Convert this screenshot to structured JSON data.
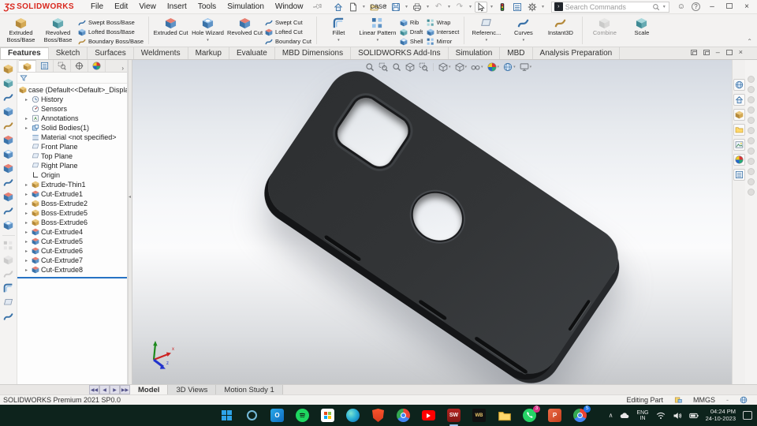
{
  "colors": {
    "sw_red": "#d9281e",
    "accent_blue": "#2673c4",
    "taskbar_bg": "#0d231c",
    "viewport_top": "#d4d9e1",
    "case_dark": "#2f3133"
  },
  "titlebar": {
    "logo_mark": "ƷS",
    "logo": "SOLIDWORKS",
    "menus": [
      "File",
      "Edit",
      "View",
      "Insert",
      "Tools",
      "Simulation",
      "Window"
    ],
    "title": "case",
    "search_placeholder": "Search Commands"
  },
  "ribbon": {
    "extruded_boss": "Extruded Boss/Base",
    "revolved_boss": "Revolved Boss/Base",
    "swept_boss": "Swept Boss/Base",
    "lofted_boss": "Lofted Boss/Base",
    "boundary_boss": "Boundary Boss/Base",
    "extruded_cut": "Extruded Cut",
    "hole_wizard": "Hole Wizard",
    "revolved_cut": "Revolved Cut",
    "swept_cut": "Swept Cut",
    "lofted_cut": "Lofted Cut",
    "boundary_cut": "Boundary Cut",
    "fillet": "Fillet",
    "linear_pattern": "Linear Pattern",
    "rib": "Rib",
    "draft": "Draft",
    "shell": "Shell",
    "wrap": "Wrap",
    "intersect": "Intersect",
    "mirror": "Mirror",
    "reference": "Referenc...",
    "curves": "Curves",
    "instant3d": "Instant3D",
    "combine": "Combine",
    "scale": "Scale"
  },
  "main_tabs": [
    "Features",
    "Sketch",
    "Surfaces",
    "Weldments",
    "Markup",
    "Evaluate",
    "MBD Dimensions",
    "SOLIDWORKS Add-Ins",
    "Simulation",
    "MBD",
    "Analysis Preparation"
  ],
  "feature_tree": {
    "root": "case (Default<<Default>_Display St",
    "items": [
      {
        "label": "History"
      },
      {
        "label": "Sensors"
      },
      {
        "label": "Annotations"
      },
      {
        "label": "Solid Bodies(1)"
      },
      {
        "label": "Material <not specified>"
      },
      {
        "label": "Front Plane"
      },
      {
        "label": "Top Plane"
      },
      {
        "label": "Right Plane"
      },
      {
        "label": "Origin"
      },
      {
        "label": "Extrude-Thin1"
      },
      {
        "label": "Cut-Extrude1"
      },
      {
        "label": "Boss-Extrude2"
      },
      {
        "label": "Boss-Extrude5"
      },
      {
        "label": "Boss-Extrude6"
      },
      {
        "label": "Cut-Extrude4"
      },
      {
        "label": "Cut-Extrude5"
      },
      {
        "label": "Cut-Extrude6"
      },
      {
        "label": "Cut-Extrude7"
      },
      {
        "label": "Cut-Extrude8"
      }
    ]
  },
  "doc_tabs": [
    "Model",
    "3D Views",
    "Motion Study 1"
  ],
  "statusbar": {
    "product": "SOLIDWORKS Premium 2021 SP0.0",
    "mode": "Editing Part",
    "units": "MMGS",
    "separator": "-"
  },
  "taskbar": {
    "icons": [
      {
        "name": "start"
      },
      {
        "name": "search"
      },
      {
        "name": "outlook",
        "glyph": "O"
      },
      {
        "name": "spotify"
      },
      {
        "name": "store"
      },
      {
        "name": "edge"
      },
      {
        "name": "brave"
      },
      {
        "name": "chrome"
      },
      {
        "name": "youtube"
      },
      {
        "name": "solidworks",
        "glyph": "SW"
      },
      {
        "name": "wb",
        "glyph": "WB"
      },
      {
        "name": "explorer"
      },
      {
        "name": "whatsapp",
        "badge": "3"
      },
      {
        "name": "powerpoint",
        "glyph": "P"
      },
      {
        "name": "chrome-profile",
        "badge": "S"
      }
    ],
    "tray": {
      "lang_top": "ENG",
      "lang_bottom": "IN",
      "time": "04:24 PM",
      "date": "24-10-2023"
    }
  }
}
